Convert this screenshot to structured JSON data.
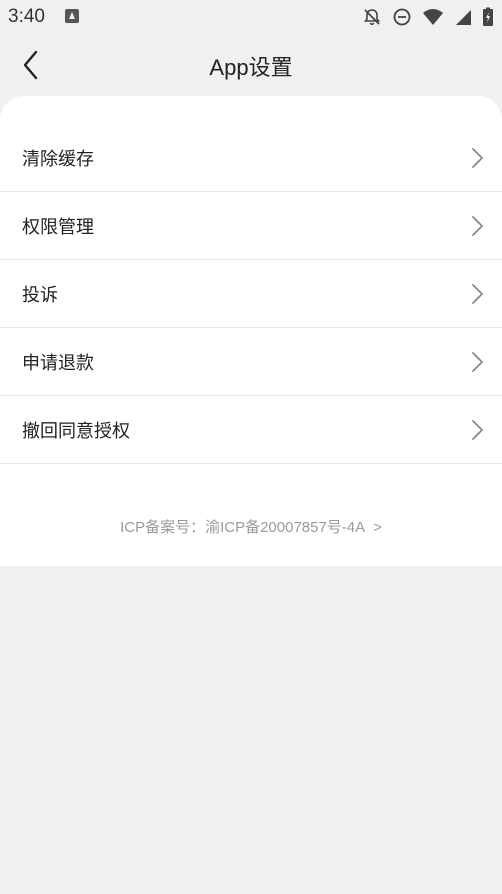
{
  "status_bar": {
    "time": "3:40"
  },
  "header": {
    "title": "App设置"
  },
  "menu": {
    "items": [
      {
        "label": "清除缓存"
      },
      {
        "label": "权限管理"
      },
      {
        "label": "投诉"
      },
      {
        "label": "申请退款"
      },
      {
        "label": "撤回同意授权"
      }
    ]
  },
  "footer": {
    "icp_text": "ICP备案号：渝ICP备20007857号-4A",
    "icp_arrow": ">"
  },
  "colors": {
    "background": "#f0f0f0",
    "card": "#ffffff",
    "divider": "#e6e6e6",
    "muted_text": "#9a9a9a"
  },
  "icons": {
    "back": "chevron-left-icon",
    "row_arrow": "chevron-right-icon"
  }
}
